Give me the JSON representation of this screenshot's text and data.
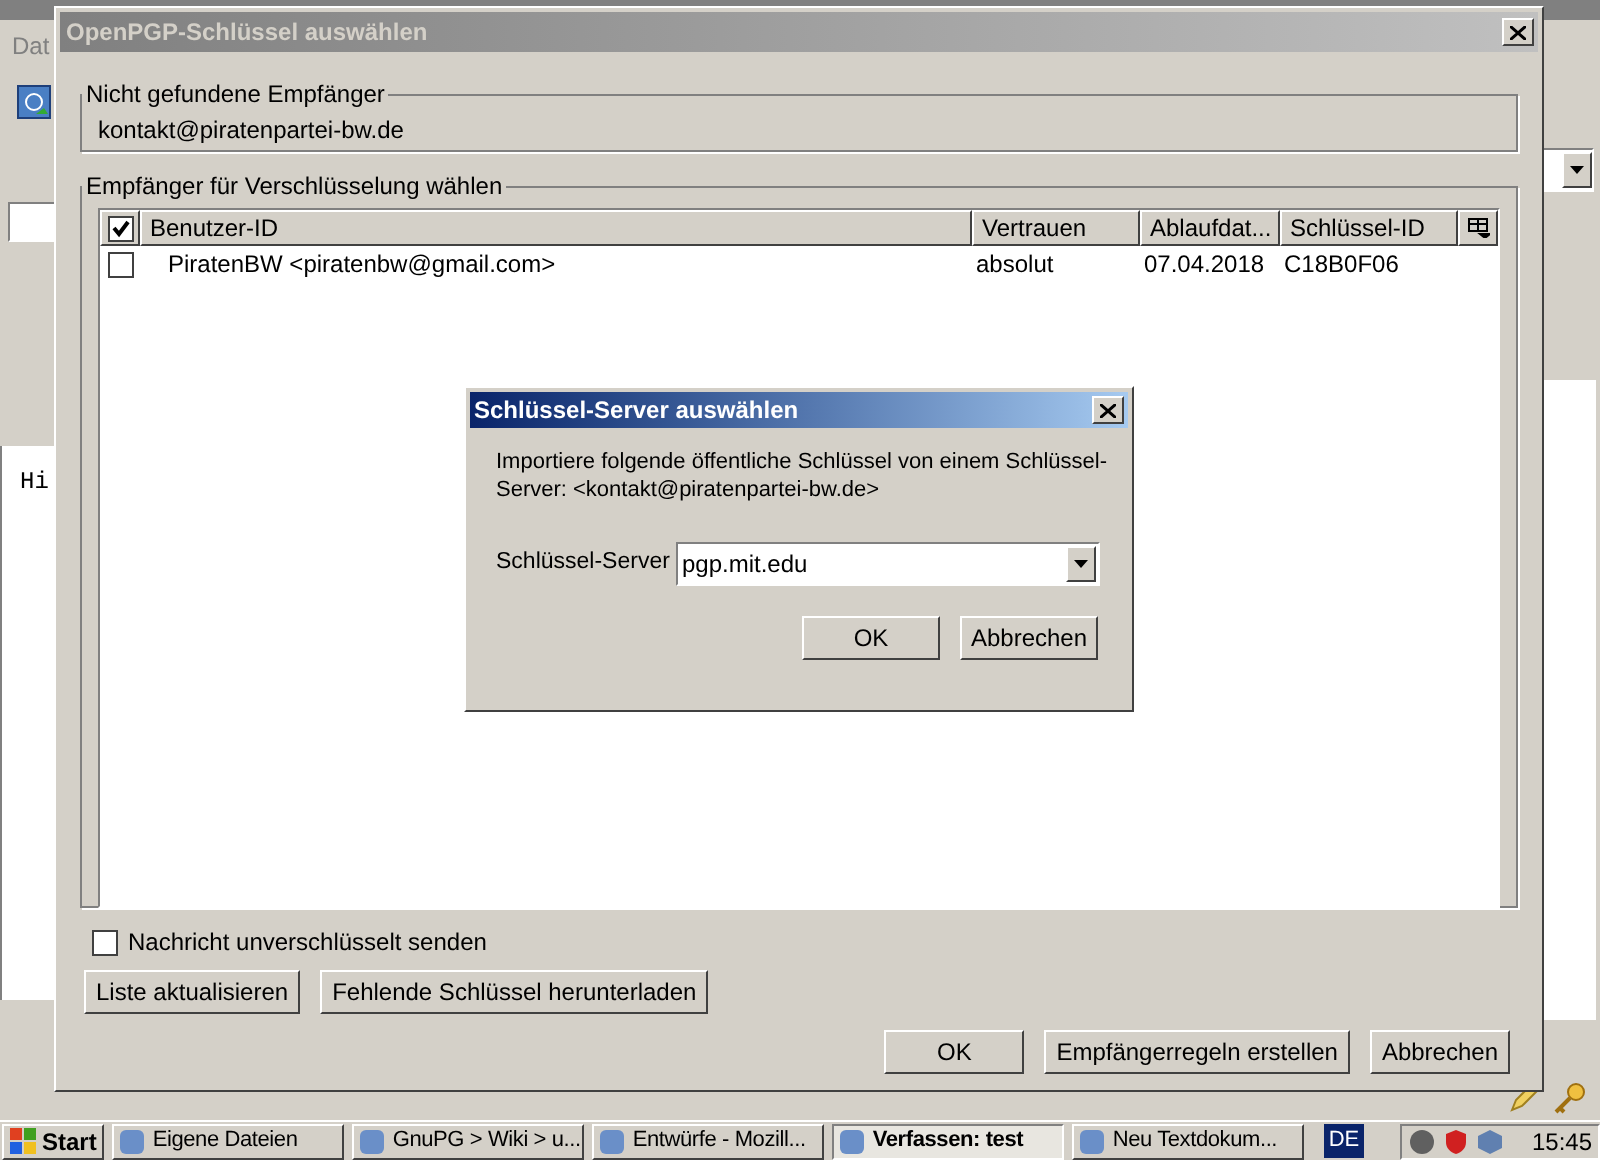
{
  "background_window": {
    "menu_item": "Dat",
    "body_text": "Hi"
  },
  "dialog": {
    "title": "OpenPGP-Schlüssel auswählen",
    "active": false,
    "not_found": {
      "legend": "Nicht gefundene Empfänger",
      "address": "kontakt@piratenpartei-bw.de"
    },
    "recipients": {
      "legend": "Empfänger für Verschlüsselung wählen",
      "header_checked": true,
      "columns": [
        "Benutzer-ID",
        "Vertrauen",
        "Ablaufdat...",
        "Schlüssel-ID"
      ],
      "rows": [
        {
          "checked": false,
          "cells": [
            "PiratenBW <piratenbw@gmail.com>",
            "absolut",
            "07.04.2018",
            "C18B0F06"
          ]
        }
      ]
    },
    "unencrypted": {
      "label": "Nachricht unverschlüsselt senden",
      "checked": false
    },
    "tool_buttons": [
      "Liste aktualisieren",
      "Fehlende Schlüssel herunterladen"
    ],
    "buttons": [
      "OK",
      "Empfängerregeln erstellen",
      "Abbrechen"
    ]
  },
  "keyserver_dialog": {
    "title": "Schlüssel-Server auswählen",
    "active": true,
    "message": "Importiere folgende öffentliche Schlüssel von einem Schlüssel-Server: <kontakt@piratenpartei-bw.de>",
    "field_label": "Schlüssel-Server",
    "value": "pgp.mit.edu",
    "buttons": [
      "OK",
      "Abbrechen"
    ]
  },
  "taskbar": {
    "start": "Start",
    "items": [
      {
        "label": "Eigene Dateien",
        "selected": false
      },
      {
        "label": "GnuPG > Wiki > u...",
        "selected": false
      },
      {
        "label": "Entwürfe - Mozill...",
        "selected": false
      },
      {
        "label": "Verfassen: test",
        "selected": true
      },
      {
        "label": "Neu Textdokum...",
        "selected": false
      }
    ],
    "language": "DE",
    "clock": "15:45"
  }
}
